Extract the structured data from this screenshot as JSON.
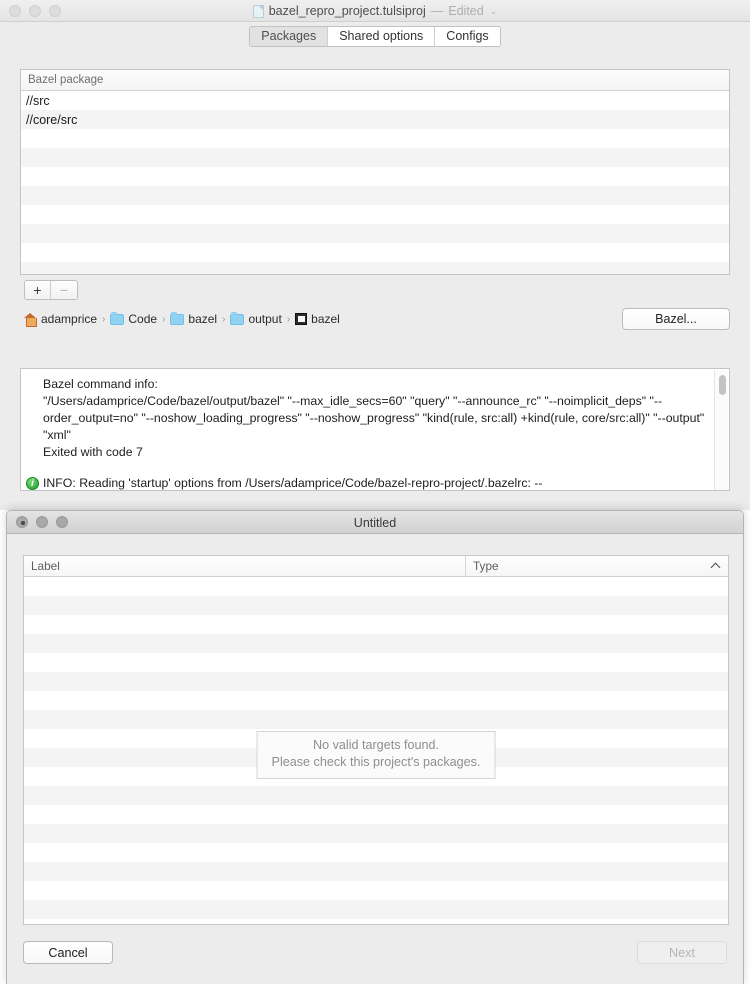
{
  "window_tulsi": {
    "title": "bazel_repro_project.tulsiproj",
    "title_separator": "—",
    "title_state": "Edited",
    "title_chevron": "⌄",
    "doc_icon": "document-icon",
    "tabs": [
      {
        "label": "Packages",
        "selected": true
      },
      {
        "label": "Shared options",
        "selected": false
      },
      {
        "label": "Configs",
        "selected": false
      }
    ],
    "package_table": {
      "column_header": "Bazel package",
      "rows": [
        "//src",
        "//core/src"
      ],
      "empty_row_count": 8
    },
    "list_controls": {
      "add_label": "+",
      "remove_label": "−"
    },
    "breadcrumb": [
      {
        "icon": "home-icon",
        "label": "adamprice"
      },
      {
        "icon": "folder-icon",
        "label": "Code"
      },
      {
        "icon": "folder-icon",
        "label": "bazel"
      },
      {
        "icon": "folder-icon",
        "label": "output"
      },
      {
        "icon": "executable-icon",
        "label": "bazel"
      }
    ],
    "breadcrumb_separator": "›",
    "bazel_button": "Bazel...",
    "console": {
      "heading": "Bazel command info:",
      "command": "\"/Users/adamprice/Code/bazel/output/bazel\" \"--max_idle_secs=60\" \"query\" \"--announce_rc\" \"--noimplicit_deps\" \"--order_output=no\" \"--noshow_loading_progress\" \"--noshow_progress\" \"kind(rule, src:all) +kind(rule, core/src:all)\" \"--output\" \"xml\"",
      "exit_line": "Exited with code 7",
      "info_icon": "info-icon",
      "info_message": "INFO: Reading 'startup' options from /Users/adamprice/Code/bazel-repro-project/.bazelrc: --"
    }
  },
  "window_targets": {
    "title": "Untitled",
    "table": {
      "columns": [
        "Label",
        "Type"
      ],
      "sort_indicator": "chevron-up-icon",
      "row_count": 19,
      "rows": []
    },
    "empty_state": {
      "line1": "No valid targets found.",
      "line2": "Please check this project's packages."
    },
    "buttons": {
      "cancel": "Cancel",
      "next": "Next"
    }
  },
  "colors": {
    "window_chrome": "#ececec",
    "table_stripe": "#f4f4f4",
    "info_green": "#1d9b2a",
    "folder_blue": "#8fd2f2",
    "home_orange": "#c86a2a"
  }
}
